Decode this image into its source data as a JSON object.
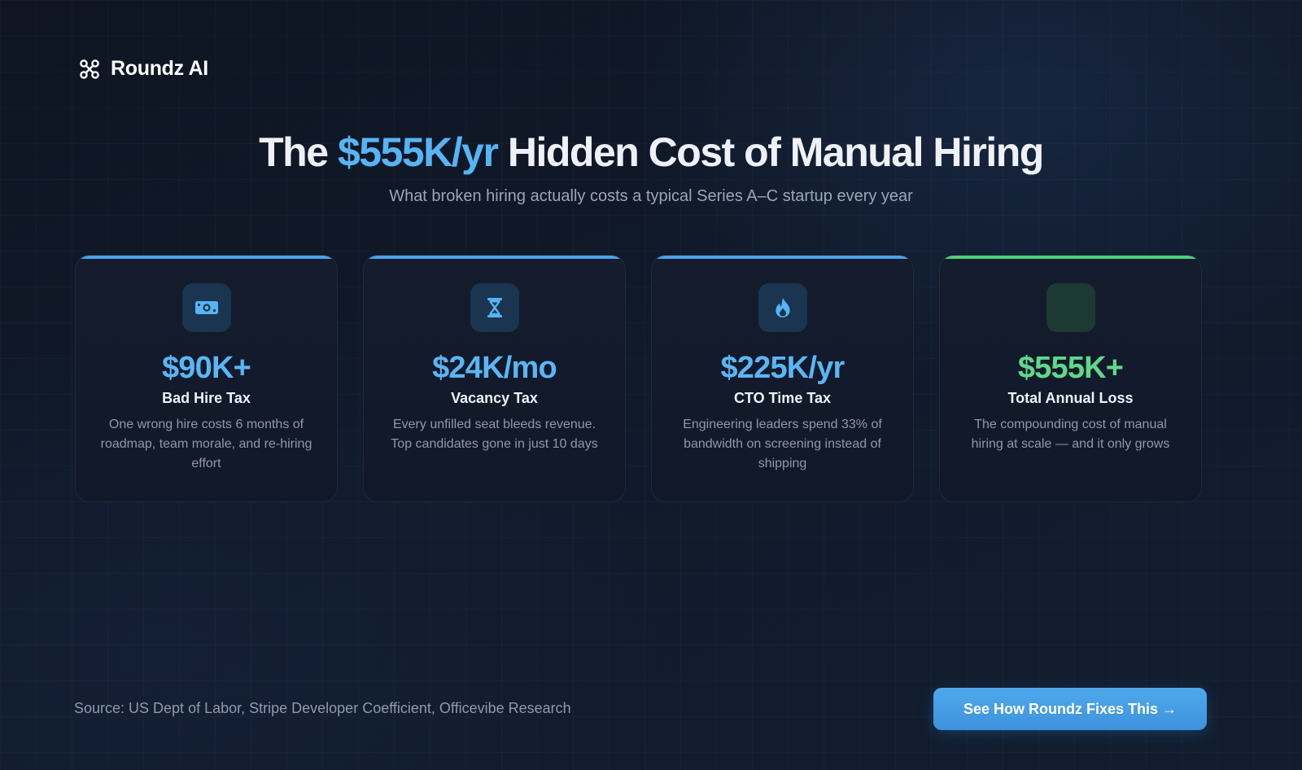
{
  "brand": {
    "name": "Roundz AI",
    "icon": "command-icon"
  },
  "headline": {
    "prefix": "The",
    "highlight": "$555K/yr",
    "suffix": "Hidden Cost of Manual Hiring"
  },
  "subtitle": "What broken hiring actually costs a typical Series A–C startup every year",
  "cards": [
    {
      "icon": "money-bill-icon",
      "value": "$90K+",
      "label": "Bad Hire Tax",
      "description": "One wrong hire costs 6 months of roadmap, team morale, and re-hiring effort",
      "accent": "#4aa4ea"
    },
    {
      "icon": "hourglass-icon",
      "value": "$24K/mo",
      "label": "Vacancy Tax",
      "description": "Every unfilled seat bleeds revenue. Top candidates gone in just 10 days",
      "accent": "#4aa4ea"
    },
    {
      "icon": "fire-icon",
      "value": "$225K/yr",
      "label": "CTO Time Tax",
      "description": "Engineering leaders spend 33% of bandwidth on screening instead of shipping",
      "accent": "#4aa4ea"
    },
    {
      "icon": "blank-icon",
      "value": "$555K+",
      "label": "Total Annual Loss",
      "description": "The compounding cost of manual hiring at scale — and it only grows",
      "accent": "#4ed07a"
    }
  ],
  "footer": {
    "source": "Source: US Dept of Labor, Stripe Developer Coefficient, Officevibe Research",
    "cta_label": "See How Roundz Fixes This →"
  }
}
